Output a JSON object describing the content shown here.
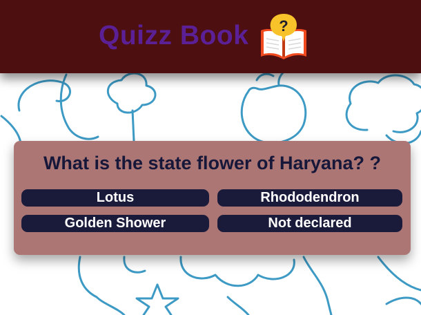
{
  "header": {
    "title": "Quizz Book",
    "logo_icon": "book-question-icon"
  },
  "quiz": {
    "question": "What is the state flower of Haryana? ?",
    "answers": [
      "Lotus",
      "Rhododendron",
      "Golden Shower",
      "Not declared"
    ]
  },
  "colors": {
    "header_bg": "#4d0f10",
    "title_purple": "#5b2096",
    "card_bg": "#ab7674",
    "button_bg": "#1a1a3a",
    "doodle_blue": "#3d9ac4"
  }
}
